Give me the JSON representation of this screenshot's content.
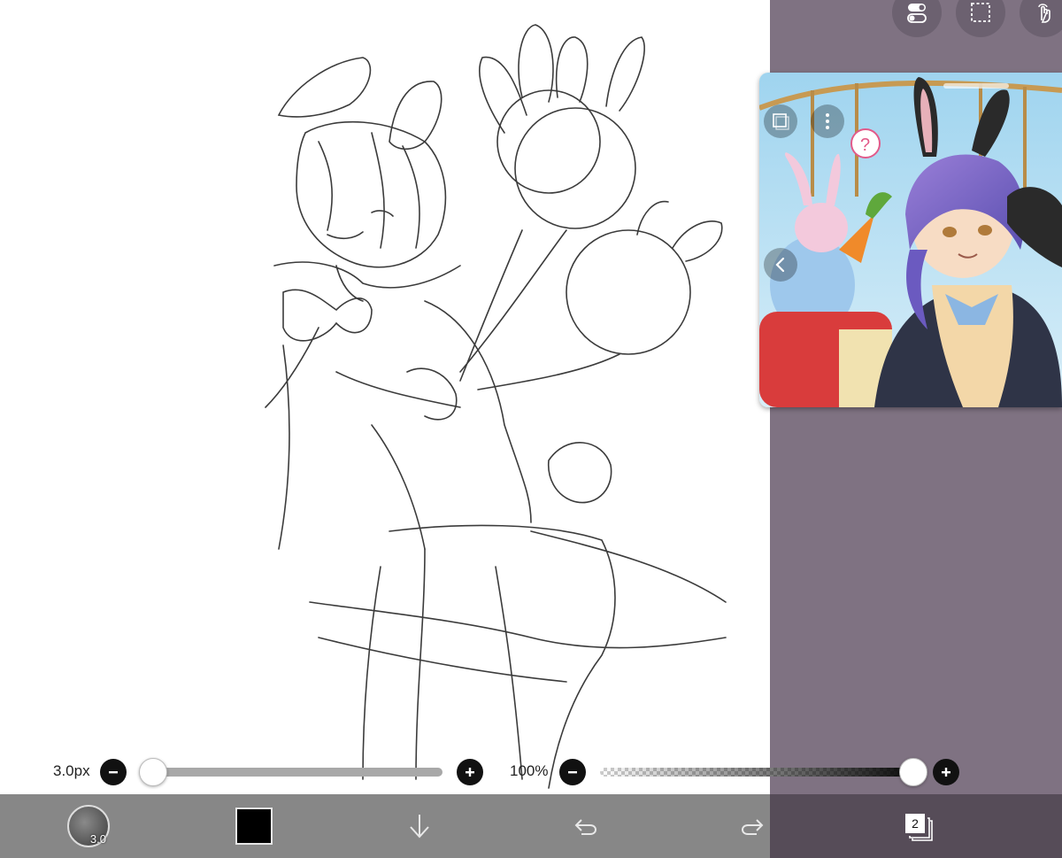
{
  "brush_slider": {
    "label": "3.0px",
    "value_fraction": 0.0
  },
  "opacity_slider": {
    "label": "100%",
    "value_fraction": 1.0
  },
  "toolbar": {
    "brush_size_label": "3.0",
    "layer_count": "2",
    "color": "#000000"
  },
  "icons": [
    "toggle-switch-icon",
    "selection-icon",
    "touch-gesture-icon",
    "layer-icon",
    "more-options-icon",
    "chevron-left-icon",
    "minus-icon",
    "plus-icon",
    "arrow-down-icon",
    "undo-icon",
    "redo-icon",
    "layers-icon"
  ],
  "colors": {
    "canvas": "#ffffff",
    "side_panel": "#7f7282",
    "toolbar": "#878787",
    "toolbar_dark": "#564c58"
  }
}
